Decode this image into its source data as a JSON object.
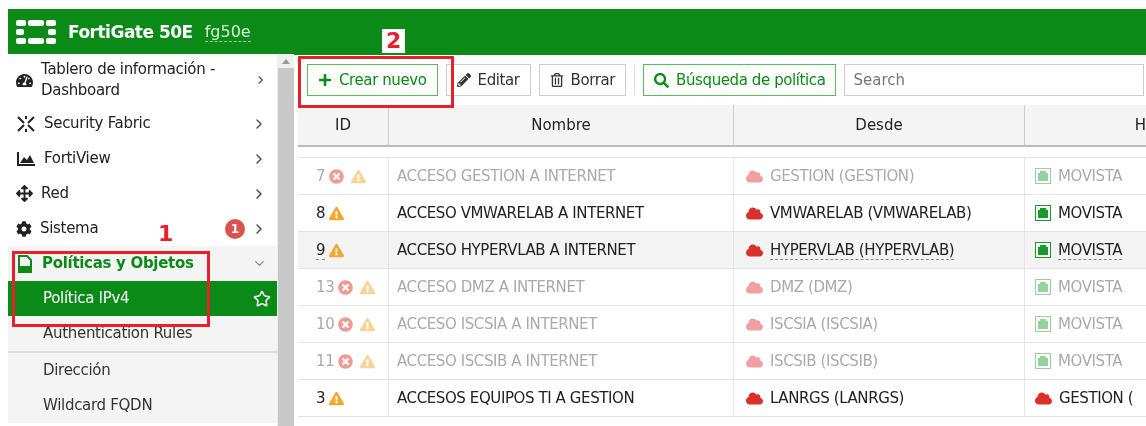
{
  "header": {
    "product": "FortiGate 50E",
    "hostname": "fg50e"
  },
  "sidebar": {
    "items": [
      {
        "label": "Tablero de información - Dashboard",
        "expanded": false
      },
      {
        "label": "Security Fabric",
        "expanded": false
      },
      {
        "label": "FortiView",
        "expanded": false
      },
      {
        "label": "Red",
        "expanded": false
      },
      {
        "label": "Sistema",
        "expanded": false,
        "badge": "1"
      },
      {
        "label": "Políticas y Objetos",
        "expanded": true,
        "children": [
          {
            "label": "Política IPv4",
            "selected": true
          },
          {
            "label": "Authentication Rules",
            "selected": false,
            "separator_after": true
          },
          {
            "label": "Dirección",
            "selected": false
          },
          {
            "label": "Wildcard FQDN",
            "selected": false
          }
        ]
      }
    ]
  },
  "toolbar": {
    "buttons": [
      {
        "label": "Crear nuevo",
        "kind": "create"
      },
      {
        "label": "Editar",
        "kind": "edit"
      },
      {
        "label": "Borrar",
        "kind": "delete"
      },
      {
        "label": "Búsqueda de política",
        "kind": "search"
      }
    ],
    "search": {
      "placeholder": "Search"
    }
  },
  "table": {
    "columns": [
      "ID",
      "Nombre",
      "Desde",
      "H"
    ],
    "rows": [
      {
        "id": "7",
        "enabled": false,
        "highlighted": false,
        "name": "ACCESO GESTION A INTERNET",
        "from": {
          "label": "GESTION (GESTION)",
          "kind": "zone"
        },
        "to": {
          "label": "MOVISTA",
          "kind": "port"
        }
      },
      {
        "id": "8",
        "enabled": true,
        "highlighted": false,
        "name": "ACCESO VMWARELAB A INTERNET",
        "from": {
          "label": "VMWARELAB (VMWARELAB)",
          "kind": "zone"
        },
        "to": {
          "label": "MOVISTA",
          "kind": "port"
        }
      },
      {
        "id": "9",
        "enabled": true,
        "highlighted": true,
        "name": "ACCESO HYPERVLAB A INTERNET",
        "from": {
          "label": "HYPERVLAB (HYPERVLAB)",
          "kind": "zone"
        },
        "to": {
          "label": "MOVISTA",
          "kind": "port"
        }
      },
      {
        "id": "13",
        "enabled": false,
        "highlighted": false,
        "name": "ACCESO DMZ A INTERNET",
        "from": {
          "label": "DMZ (DMZ)",
          "kind": "zone"
        },
        "to": {
          "label": "MOVISTA",
          "kind": "port"
        }
      },
      {
        "id": "10",
        "enabled": false,
        "highlighted": false,
        "name": "ACCESO ISCSIA A INTERNET",
        "from": {
          "label": "ISCSIA (ISCSIA)",
          "kind": "zone"
        },
        "to": {
          "label": "MOVISTA",
          "kind": "port"
        }
      },
      {
        "id": "11",
        "enabled": false,
        "highlighted": false,
        "name": "ACCESO ISCSIB A INTERNET",
        "from": {
          "label": "ISCSIB (ISCSIB)",
          "kind": "zone"
        },
        "to": {
          "label": "MOVISTA",
          "kind": "port"
        }
      },
      {
        "id": "3",
        "enabled": true,
        "highlighted": false,
        "name": "ACCESOS EQUIPOS TI A GESTION",
        "from": {
          "label": "LANRGS (LANRGS)",
          "kind": "zone"
        },
        "to": {
          "label": "GESTION (",
          "kind": "zone"
        }
      }
    ]
  },
  "annotations": [
    {
      "label": "1"
    },
    {
      "label": "2"
    }
  ]
}
